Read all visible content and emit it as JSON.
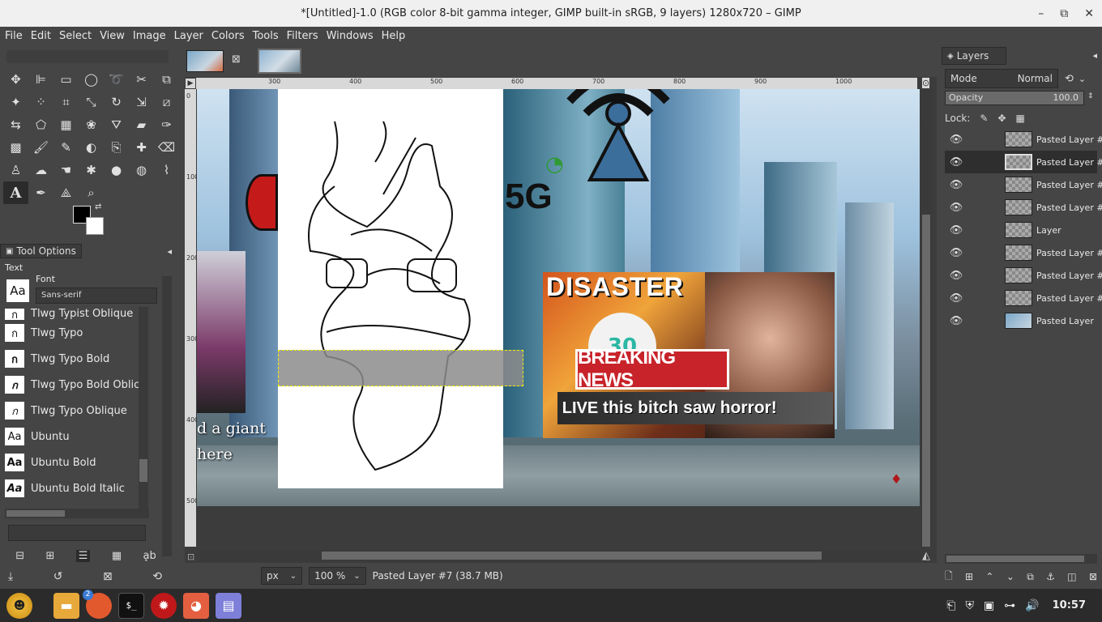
{
  "window": {
    "title": "*[Untitled]-1.0 (RGB color 8-bit gamma integer, GIMP built-in sRGB, 9 layers) 1280x720 – GIMP",
    "minimize": "–",
    "restore": "⧉",
    "close": "✕"
  },
  "menu": [
    "File",
    "Edit",
    "Select",
    "View",
    "Image",
    "Layer",
    "Colors",
    "Tools",
    "Filters",
    "Windows",
    "Help"
  ],
  "tool_options": {
    "tab_label": "Tool Options",
    "section_label": "Text",
    "font_label": "Font",
    "font_value": "Sans-serif",
    "font_icon": "Aa",
    "fonts": [
      {
        "name": "Tlwg Typist Oblique",
        "icon": "ก"
      },
      {
        "name": "Tlwg Typo",
        "icon": "ก"
      },
      {
        "name": "Tlwg Typo Bold",
        "icon": "ก"
      },
      {
        "name": "Tlwg Typo Bold Oblic",
        "icon": "ก"
      },
      {
        "name": "Tlwg Typo Oblique",
        "icon": "ก"
      },
      {
        "name": "Ubuntu",
        "icon": "Aa"
      },
      {
        "name": "Ubuntu Bold",
        "icon": "Aa"
      },
      {
        "name": "Ubuntu Bold Italic",
        "icon": "Aa"
      }
    ]
  },
  "ruler": {
    "h_ticks": [
      "300",
      "400",
      "500",
      "600",
      "700",
      "800",
      "900",
      "1000"
    ],
    "v_ticks": [
      "0",
      "100",
      "200",
      "300",
      "400",
      "500"
    ]
  },
  "canvas_text": {
    "disaster": "DISASTER",
    "breaking": "BREAKING NEWS",
    "live": "LIVE",
    "caption": "this bitch saw horror!",
    "fiveg": "5G",
    "left_caption_1": "d a giant",
    "left_caption_2": "here",
    "number": "30"
  },
  "status": {
    "unit": "px",
    "zoom": "100 %",
    "info": "Pasted Layer #7 (38.7 MB)"
  },
  "layers": {
    "tab_label": "Layers",
    "mode_label": "Mode",
    "mode_value": "Normal",
    "opacity_label": "Opacity",
    "opacity_value": "100.0",
    "opacity_level": 1.0,
    "lock_label": "Lock:",
    "items": [
      {
        "name": "Pasted Layer #"
      },
      {
        "name": "Pasted Layer #"
      },
      {
        "name": "Pasted Layer #"
      },
      {
        "name": "Pasted Layer #"
      },
      {
        "name": "Layer"
      },
      {
        "name": "Pasted Layer #"
      },
      {
        "name": "Pasted Layer #"
      },
      {
        "name": "Pasted Layer #"
      },
      {
        "name": "Pasted Layer"
      }
    ],
    "selected_index": 1
  },
  "taskbar": {
    "clock": "10:57",
    "badge": "2"
  },
  "colors": {
    "fg": "#000000",
    "bg": "#ffffff",
    "breaking_red": "#c8232a"
  }
}
